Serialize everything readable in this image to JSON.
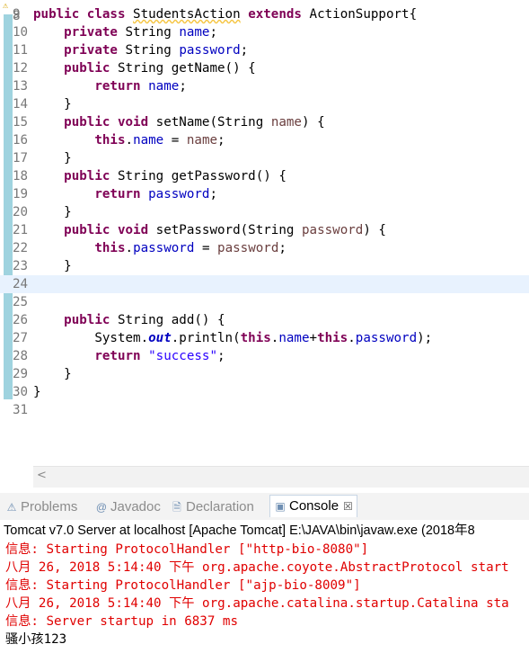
{
  "editor": {
    "first_line_partial": "8",
    "lines": [
      {
        "n": "9",
        "tokens": [
          {
            "t": "public class ",
            "c": "kw"
          },
          {
            "t": "StudentsAction",
            "c": "squiggle"
          },
          {
            "t": " "
          },
          {
            "t": "extends",
            "c": "kw"
          },
          {
            "t": " ActionSupport{"
          }
        ]
      },
      {
        "n": "10",
        "tokens": [
          {
            "t": "    "
          },
          {
            "t": "private",
            "c": "kw"
          },
          {
            "t": " String "
          },
          {
            "t": "name",
            "c": "fld"
          },
          {
            "t": ";"
          }
        ]
      },
      {
        "n": "11",
        "tokens": [
          {
            "t": "    "
          },
          {
            "t": "private",
            "c": "kw"
          },
          {
            "t": " String "
          },
          {
            "t": "password",
            "c": "fld"
          },
          {
            "t": ";"
          }
        ]
      },
      {
        "n": "12",
        "tokens": [
          {
            "t": "    "
          },
          {
            "t": "public",
            "c": "kw"
          },
          {
            "t": " String getName() {"
          }
        ]
      },
      {
        "n": "13",
        "tokens": [
          {
            "t": "        "
          },
          {
            "t": "return",
            "c": "kw"
          },
          {
            "t": " "
          },
          {
            "t": "name",
            "c": "fld"
          },
          {
            "t": ";"
          }
        ]
      },
      {
        "n": "14",
        "tokens": [
          {
            "t": "    }"
          }
        ]
      },
      {
        "n": "15",
        "tokens": [
          {
            "t": "    "
          },
          {
            "t": "public void",
            "c": "kw"
          },
          {
            "t": " setName(String "
          },
          {
            "t": "name",
            "c": "prm"
          },
          {
            "t": ") {"
          }
        ]
      },
      {
        "n": "16",
        "tokens": [
          {
            "t": "        "
          },
          {
            "t": "this",
            "c": "kw"
          },
          {
            "t": "."
          },
          {
            "t": "name",
            "c": "fld"
          },
          {
            "t": " = "
          },
          {
            "t": "name",
            "c": "prm"
          },
          {
            "t": ";"
          }
        ]
      },
      {
        "n": "17",
        "tokens": [
          {
            "t": "    }"
          }
        ]
      },
      {
        "n": "18",
        "tokens": [
          {
            "t": "    "
          },
          {
            "t": "public",
            "c": "kw"
          },
          {
            "t": " String getPassword() {"
          }
        ]
      },
      {
        "n": "19",
        "tokens": [
          {
            "t": "        "
          },
          {
            "t": "return",
            "c": "kw"
          },
          {
            "t": " "
          },
          {
            "t": "password",
            "c": "fld"
          },
          {
            "t": ";"
          }
        ]
      },
      {
        "n": "20",
        "tokens": [
          {
            "t": "    }"
          }
        ]
      },
      {
        "n": "21",
        "tokens": [
          {
            "t": "    "
          },
          {
            "t": "public void",
            "c": "kw"
          },
          {
            "t": " setPassword(String "
          },
          {
            "t": "password",
            "c": "prm"
          },
          {
            "t": ") {"
          }
        ]
      },
      {
        "n": "22",
        "tokens": [
          {
            "t": "        "
          },
          {
            "t": "this",
            "c": "kw"
          },
          {
            "t": "."
          },
          {
            "t": "password",
            "c": "fld"
          },
          {
            "t": " = "
          },
          {
            "t": "password",
            "c": "prm"
          },
          {
            "t": ";"
          }
        ]
      },
      {
        "n": "23",
        "tokens": [
          {
            "t": "    }"
          }
        ]
      },
      {
        "n": "24",
        "current": true,
        "tokens": []
      },
      {
        "n": "25",
        "tokens": []
      },
      {
        "n": "26",
        "tokens": [
          {
            "t": "    "
          },
          {
            "t": "public",
            "c": "kw"
          },
          {
            "t": " String add() {"
          }
        ]
      },
      {
        "n": "27",
        "tokens": [
          {
            "t": "        System."
          },
          {
            "t": "out",
            "c": "sfld"
          },
          {
            "t": ".println("
          },
          {
            "t": "this",
            "c": "kw"
          },
          {
            "t": "."
          },
          {
            "t": "name",
            "c": "fld"
          },
          {
            "t": "+"
          },
          {
            "t": "this",
            "c": "kw"
          },
          {
            "t": "."
          },
          {
            "t": "password",
            "c": "fld"
          },
          {
            "t": ");"
          }
        ]
      },
      {
        "n": "28",
        "tokens": [
          {
            "t": "        "
          },
          {
            "t": "return",
            "c": "kw"
          },
          {
            "t": " "
          },
          {
            "t": "\"success\"",
            "c": "str"
          },
          {
            "t": ";"
          }
        ]
      },
      {
        "n": "29",
        "tokens": [
          {
            "t": "    }"
          }
        ]
      },
      {
        "n": "30",
        "tokens": [
          {
            "t": "}"
          }
        ]
      },
      {
        "n": "31",
        "tokens": []
      }
    ],
    "scroll_left_glyph": "<"
  },
  "tabs": [
    {
      "label": "Problems",
      "icon": "problems-icon",
      "glyph": "⚠",
      "active": false
    },
    {
      "label": "Javadoc",
      "icon": "javadoc-icon",
      "glyph": "@",
      "active": false
    },
    {
      "label": "Declaration",
      "icon": "declaration-icon",
      "glyph": "🗎",
      "active": false
    },
    {
      "label": "Console",
      "icon": "console-icon",
      "glyph": "▣",
      "active": true,
      "close": "☒"
    }
  ],
  "console": {
    "title": "Tomcat v7.0 Server at localhost [Apache Tomcat] E:\\JAVA\\bin\\javaw.exe (2018年8",
    "lines": [
      {
        "text": "信息: Starting ProtocolHandler [\"http-bio-8080\"]",
        "kind": "err"
      },
      {
        "text": "八月 26, 2018 5:14:40 下午 org.apache.coyote.AbstractProtocol start",
        "kind": "err"
      },
      {
        "text": "信息: Starting ProtocolHandler [\"ajp-bio-8009\"]",
        "kind": "err"
      },
      {
        "text": "八月 26, 2018 5:14:40 下午 org.apache.catalina.startup.Catalina sta",
        "kind": "err"
      },
      {
        "text": "信息: Server startup in 6837 ms",
        "kind": "err"
      },
      {
        "text": "骚小孩123",
        "kind": "out"
      }
    ]
  },
  "colors": {
    "keyword": "#7f0055",
    "field": "#0000c0",
    "string": "#2a00ff",
    "stderr": "#e00000",
    "current_line": "#e8f2fe"
  }
}
